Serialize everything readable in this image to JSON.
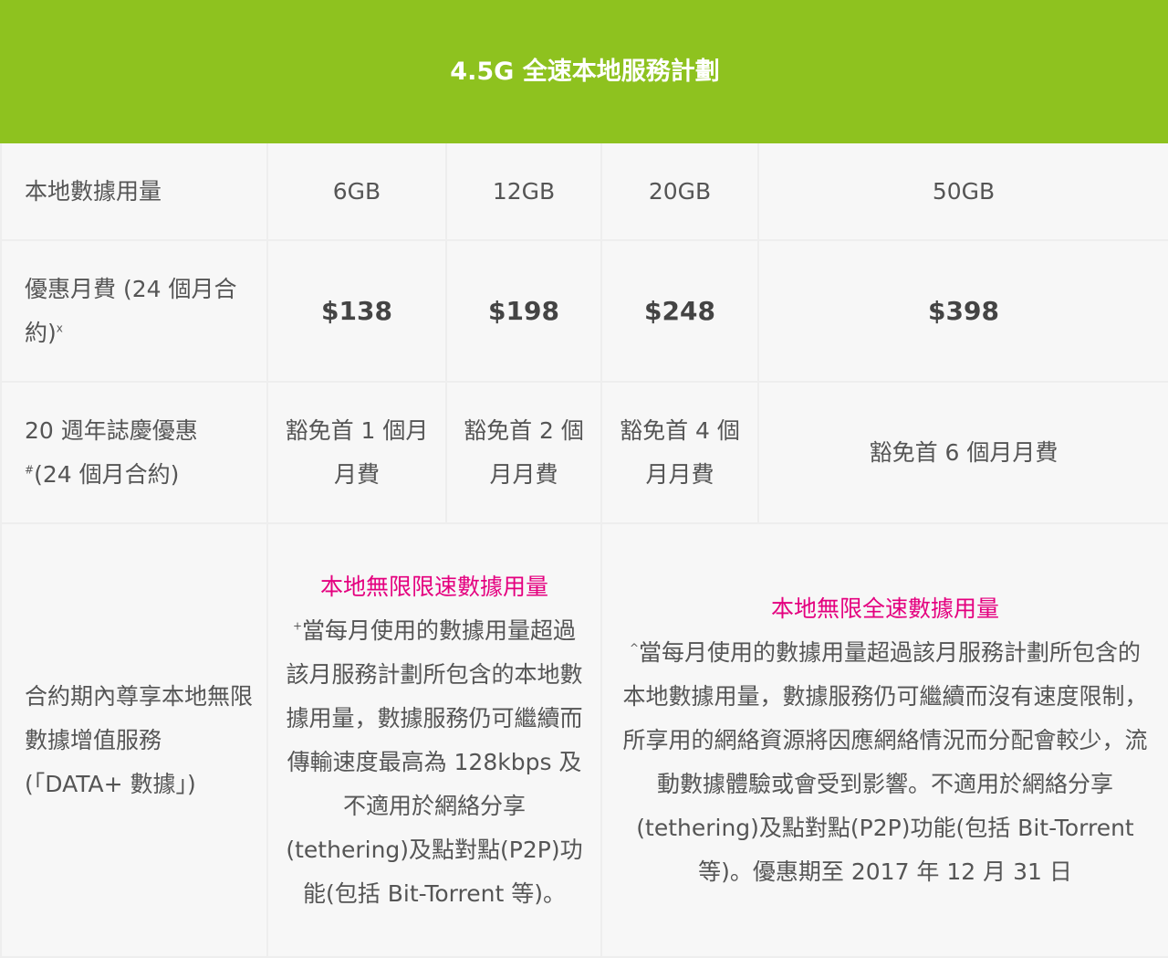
{
  "header": {
    "title": "4.5G 全速本地服務計劃"
  },
  "rows": {
    "data_usage": {
      "label": "本地數據用量",
      "values": [
        "6GB",
        "12GB",
        "20GB",
        "50GB"
      ]
    },
    "monthly_fee": {
      "label": "優惠月費 (24 個月合約)",
      "label_sup": "x",
      "values": [
        "$138",
        "$198",
        "$248",
        "$398"
      ]
    },
    "anniversary": {
      "label_line1": "20 週年誌慶優惠",
      "label_sup": "#",
      "label_line2": "(24 個月合約)",
      "values": [
        "豁免首 1 個月月費",
        "豁免首 2 個月月費",
        "豁免首 4 個月月費",
        "豁免首 6 個月月費"
      ]
    },
    "unlimited": {
      "label": "合約期內尊享本地無限數據增值服務 (「DATA+ 數據」)",
      "limited": {
        "title": "本地無限限速數據用量",
        "sup": "+",
        "text": "當每月使用的數據用量超過該月服務計劃所包含的本地數據用量，數據服務仍可繼續而傳輸速度最高為 128kbps 及不適用於網絡分享(tethering)及點對點(P2P)功能(包括 Bit-Torrent 等)。"
      },
      "full": {
        "title": "本地無限全速數據用量",
        "sup": "^",
        "text": "當每月使用的數據用量超過該月服務計劃所包含的本地數據用量，數據服務仍可繼續而沒有速度限制，所享用的網絡資源將因應網絡情況而分配會較少，流動數據體驗或會受到影響。不適用於網絡分享(tethering)及點對點(P2P)功能(包括 Bit-Torrent 等)。優惠期至 2017 年 12 月 31 日"
      }
    }
  },
  "colors": {
    "header_bg": "#8ec21f",
    "cell_bg": "#f7f7f7",
    "border": "#eeeeee",
    "highlight": "#e4007f"
  }
}
